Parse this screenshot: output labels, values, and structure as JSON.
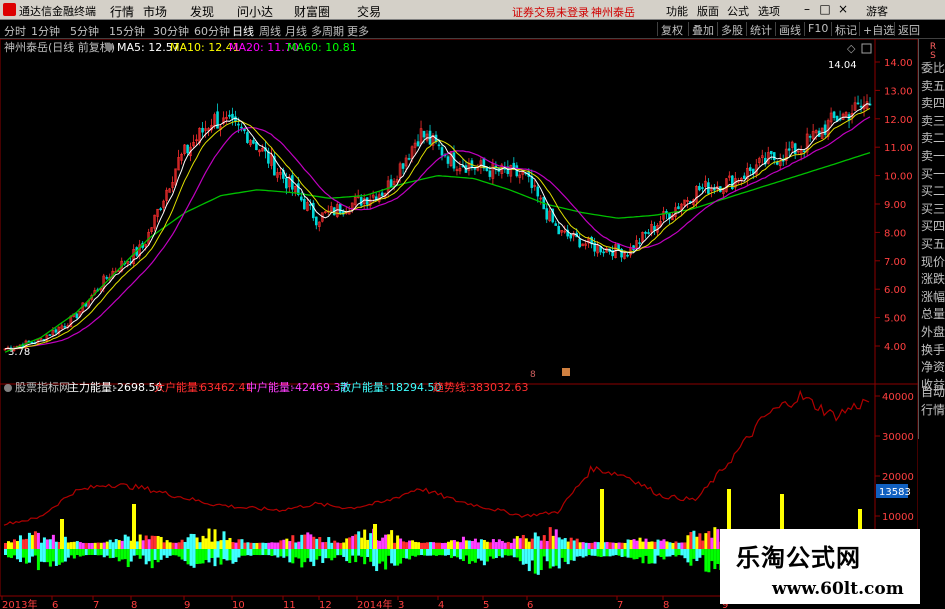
{
  "menubar": {
    "app_title": "通达信金融终端",
    "menus": [
      "行情",
      "市场",
      "发现",
      "问小达",
      "财富圈",
      "交易"
    ],
    "notice": "证券交易未登录",
    "stock_name_top": "神州泰岳",
    "right_buttons": [
      "功能",
      "版面",
      "公式",
      "选项"
    ],
    "guest": "游客"
  },
  "toolbar": {
    "periods": [
      "分时",
      "1分钟",
      "5分钟",
      "15分钟",
      "30分钟",
      "60分钟",
      "日线",
      "周线",
      "月线",
      "多周期",
      "更多"
    ],
    "active_period": "日线",
    "tools": [
      "复权",
      "叠加",
      "多股",
      "统计",
      "画线",
      "F10",
      "标记",
      "+自选",
      "返回"
    ]
  },
  "main_header": {
    "stock": "神州泰岳(日线 前复权)",
    "ma5": "MA5: 12.57",
    "ma10": "MA10: 12.41",
    "ma20": "MA20: 11.70",
    "ma60": "MA60: 10.81"
  },
  "colors": {
    "ma5": "#ffffff",
    "ma10": "#ffff00",
    "ma20": "#ff00ff",
    "ma60": "#00ff00",
    "up": "#ff3030",
    "down": "#00e0e0",
    "line": "#c00000"
  },
  "price_axis": [
    "14.00",
    "13.00",
    "12.00",
    "11.00",
    "10.00",
    "9.00",
    "8.00",
    "7.00",
    "6.00",
    "5.00",
    "4.00"
  ],
  "price_high_label": "14.04",
  "price_low_label": "3.78",
  "lower_header": {
    "name": "股票指标网",
    "main_label": "主力能量:",
    "main_value": "-2698.50",
    "big_label": "大户能量:",
    "big_value": "63462.41",
    "mid_label": "中户能量:",
    "mid_value": "-42469.37",
    "small_label": "散户能量:",
    "small_value": "-18294.50",
    "trend_label": "趋势线:",
    "trend_value": "383032.63"
  },
  "lower_axis": [
    "40000",
    "30000",
    "20000",
    "10000"
  ],
  "lower_current": "13583",
  "time_axis": [
    "2013年",
    "6",
    "7",
    "8",
    "9",
    "10",
    "11",
    "12",
    "2014年",
    "3",
    "4",
    "5",
    "6",
    "7",
    "8",
    "9"
  ],
  "right_panel": {
    "tabs_top": [
      "R",
      "S"
    ],
    "items": [
      "委比",
      "卖五",
      "卖四",
      "卖三",
      "卖二",
      "卖一",
      "买一",
      "买二",
      "买三",
      "买四",
      "买五",
      "现价",
      "涨跌",
      "涨幅",
      "总量",
      "外盘",
      "换手",
      "净资",
      "收益"
    ],
    "bottom_tabs": [
      "自动",
      "行情"
    ]
  },
  "watermark": {
    "title": "乐淘公式网",
    "url": "www.60lt.com"
  },
  "chart_data": {
    "type": "candlestick",
    "title": "神州泰岳(日线 前复权)",
    "ma60_trend": [
      3.78,
      4.3,
      5.2,
      6.5,
      7.8,
      8.7,
      9.3,
      9.5,
      9.4,
      9.2,
      9.3,
      9.7,
      10.0,
      9.9,
      9.5,
      9.0,
      8.7,
      8.5,
      8.6,
      8.8,
      9.2,
      9.6,
      10.0,
      10.4,
      10.81
    ],
    "close_trend": [
      3.9,
      4.2,
      5.0,
      6.5,
      7.5,
      10.5,
      12.0,
      11.5,
      10.0,
      8.5,
      9.0,
      9.5,
      11.5,
      10.5,
      10.2,
      10.0,
      8.0,
      7.5,
      7.3,
      8.5,
      9.5,
      9.8,
      10.5,
      11.0,
      12.0,
      12.57
    ],
    "ylim": [
      3.5,
      14.5
    ],
    "lower": {
      "trend_line": [
        8000,
        9500,
        16000,
        18000,
        17000,
        15000,
        13000,
        12000,
        11500,
        13000,
        12000,
        13500,
        17000,
        14000,
        12000,
        10000,
        11000,
        22000,
        20000,
        15000,
        14000,
        24000,
        35000,
        40000,
        35000,
        39000
      ],
      "ylim": [
        0,
        42000
      ]
    }
  }
}
